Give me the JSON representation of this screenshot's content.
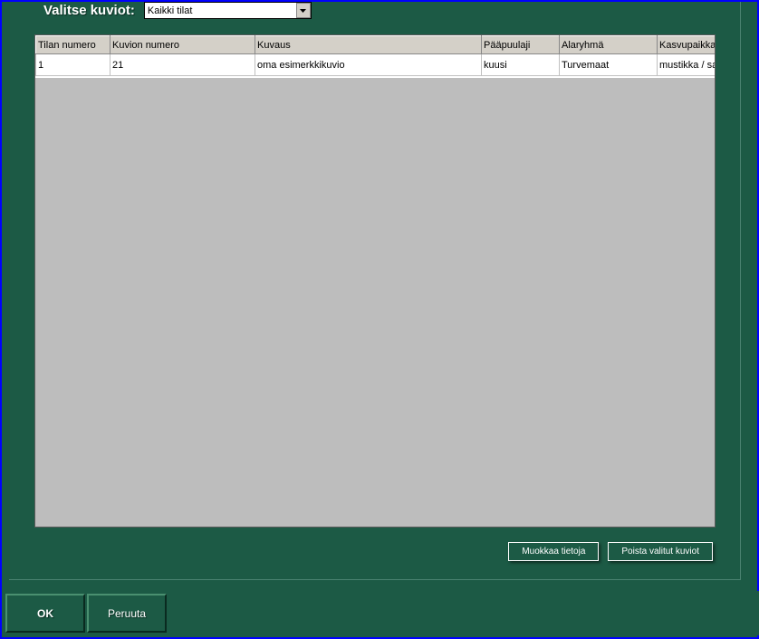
{
  "filter": {
    "label": "Valitse kuviot:",
    "selected": "Kaikki tilat"
  },
  "table": {
    "headers": {
      "tila_numero": "Tilan numero",
      "kuvion_numero": "Kuvion numero",
      "kuvaus": "Kuvaus",
      "paapuulaji": "Pääpuulaji",
      "alaryhma": "Alaryhmä",
      "kasvupaikka": "Kasvupaikka"
    },
    "rows": [
      {
        "tila_numero": "1",
        "kuvion_numero": "21",
        "kuvaus": "oma esimerkkikuvio",
        "paapuulaji": "kuusi",
        "alaryhma": "Turvemaat",
        "kasvupaikka": "mustikka / sa"
      }
    ]
  },
  "buttons": {
    "muokkaa": "Muokkaa tietoja",
    "poista": "Poista valitut kuviot",
    "ok": "OK",
    "peruuta": "Peruuta"
  }
}
